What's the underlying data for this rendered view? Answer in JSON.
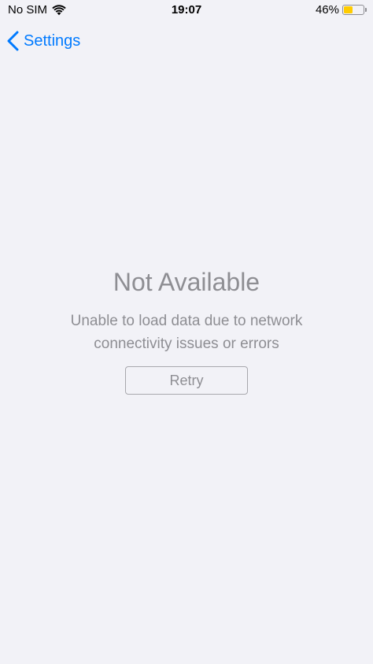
{
  "status_bar": {
    "carrier": "No SIM",
    "time": "19:07",
    "battery_text": "46%",
    "battery_level": 0.46,
    "battery_color": "#ffcc00",
    "wifi_icon": "wifi-icon"
  },
  "nav": {
    "back_label": "Settings",
    "back_icon": "chevron-left-icon",
    "accent_color": "#007aff"
  },
  "empty_state": {
    "title": "Not Available",
    "description": "Unable to load data due to network connectivity issues or errors",
    "retry_label": "Retry"
  }
}
